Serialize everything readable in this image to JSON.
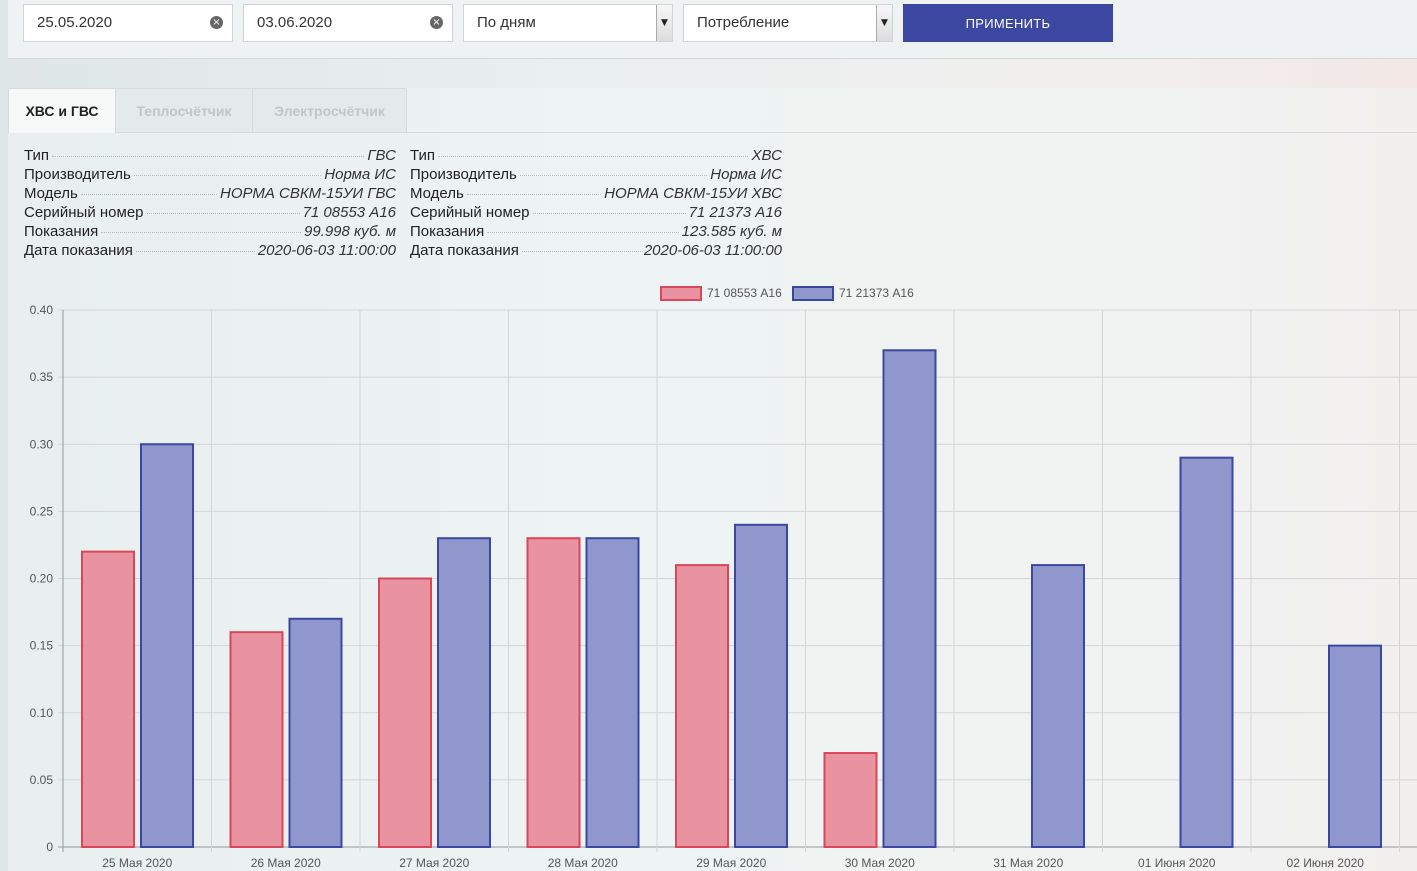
{
  "filters": {
    "date_from": "25.05.2020",
    "date_to": "03.06.2020",
    "grouping": "По дням",
    "mode": "Потребление",
    "apply_label": "ПРИМЕНИТЬ",
    "clear_glyph": "×",
    "select_arrow_glyph": "▼"
  },
  "tabs": [
    {
      "label": "ХВС и ГВС",
      "active": true
    },
    {
      "label": "Теплосчётчик",
      "active": false
    },
    {
      "label": "Электросчётчик",
      "active": false
    }
  ],
  "meters": [
    {
      "rows": [
        {
          "label": "Тип",
          "value": "ГВС"
        },
        {
          "label": "Производитель",
          "value": "Норма ИС"
        },
        {
          "label": "Модель",
          "value": "НОРМА СВКМ-15УИ ГВС"
        },
        {
          "label": "Серийный номер",
          "value": "71 08553 А16"
        },
        {
          "label": "Показания",
          "value": "99.998 куб. м"
        },
        {
          "label": "Дата показания",
          "value": "2020-06-03 11:00:00"
        }
      ]
    },
    {
      "rows": [
        {
          "label": "Тип",
          "value": "ХВС"
        },
        {
          "label": "Производитель",
          "value": "Норма ИС"
        },
        {
          "label": "Модель",
          "value": "НОРМА СВКМ-15УИ ХВС"
        },
        {
          "label": "Серийный номер",
          "value": "71 21373 А16"
        },
        {
          "label": "Показания",
          "value": "123.585 куб. м"
        },
        {
          "label": "Дата показания",
          "value": "2020-06-03 11:00:00"
        }
      ]
    }
  ],
  "chart_data": {
    "type": "bar",
    "categories": [
      "25 Мая 2020",
      "26 Мая 2020",
      "27 Мая 2020",
      "28 Мая 2020",
      "29 Мая 2020",
      "30 Мая 2020",
      "31 Мая 2020",
      "01 Июня 2020",
      "02 Июня 2020"
    ],
    "series": [
      {
        "name": "71 08553 А16",
        "values": [
          0.22,
          0.16,
          0.2,
          0.23,
          0.21,
          0.07,
          null,
          null,
          null
        ],
        "fill": "#e8939f",
        "stroke": "#d9475c"
      },
      {
        "name": "71 21373 А16",
        "values": [
          0.3,
          0.17,
          0.23,
          0.23,
          0.24,
          0.37,
          0.21,
          0.29,
          0.15
        ],
        "fill": "#8f97cc",
        "stroke": "#3b47a1"
      }
    ],
    "yticks": [
      "0.40",
      "0.35",
      "0.30",
      "0.25",
      "0.20",
      "0.15",
      "0.10",
      "0.05",
      "0"
    ],
    "ylim": [
      0,
      0.4
    ],
    "legend_position": "top-center",
    "grid": true
  }
}
